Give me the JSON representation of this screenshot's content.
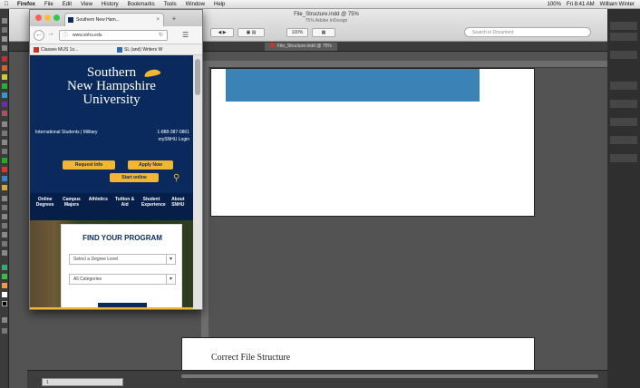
{
  "menubar": {
    "apple": "",
    "items": [
      "Firefox",
      "File",
      "Edit",
      "View",
      "History",
      "Bookmarks",
      "Tools",
      "Window",
      "Help"
    ],
    "right_status": [
      "100%",
      "Fri 8:41 AM",
      "William Winter"
    ]
  },
  "app": {
    "title": "File_Structure.indd @ 75%",
    "subtitle": "75% Adobe InDesign",
    "toolbar_zoom": "100%",
    "search_placeholder": "Search in Document",
    "doc_tab": "File_Structure.indd @ 75%",
    "artboard2_heading": "Correct File Structure",
    "status_zoom": "1"
  },
  "firefox": {
    "tab_title": "Southern New Ham...",
    "url": "www.snhu.edu",
    "bookmarks": [
      {
        "label": "Classes MUS 1s...",
        "color": "#c0392b"
      },
      {
        "label": "SL (and) Writers W",
        "color": "#2b6cb0"
      }
    ]
  },
  "snhu": {
    "logo": [
      "Southern",
      "New Hampshire",
      "University"
    ],
    "utility_links": "International Students | Military",
    "phone": "1-888-387-0861",
    "login": "mySNHU Login",
    "cta": {
      "request_info": "Request Info",
      "apply_now": "Apply Now",
      "start_online": "Start online"
    },
    "nav": [
      "Online Degrees",
      "Campus Majors",
      "Athletics",
      "Tuition & Aid",
      "Student Experience",
      "About SNHU"
    ],
    "finder": {
      "title": "FIND YOUR PROGRAM",
      "degree_placeholder": "Select a Degree Level",
      "category_placeholder": "All Categories"
    }
  },
  "colors": {
    "snhu_navy": "#0a2a5e",
    "snhu_gold": "#f2b632",
    "artboard_blue": "#3b82b6"
  }
}
